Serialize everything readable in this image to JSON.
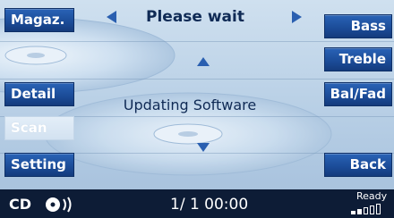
{
  "left_menu": {
    "magazine_label": "Magaz.",
    "detail_label": "Detail",
    "scan_label": "Scan",
    "setting_label": "Setting"
  },
  "right_menu": {
    "bass_label": "Bass",
    "treble_label": "Treble",
    "balance_fader_label": "Bal/Fad",
    "back_label": "Back"
  },
  "header": {
    "title": "Please wait"
  },
  "main": {
    "status_message": "Updating Software"
  },
  "status_bar": {
    "source": "CD",
    "track_time": "1/  1 00:00",
    "ready": "Ready",
    "signal_bars_filled": 2,
    "signal_bars_total": 5
  },
  "icons": {
    "prev": "left-triangle-icon",
    "next": "right-triangle-icon",
    "scroll_up": "up-triangle-icon",
    "scroll_down": "down-triangle-icon",
    "cd": "cd-disc-icon",
    "signal": "signal-strength-icon"
  },
  "colors": {
    "button": "#1b4b97",
    "screen_bg": "#b9d0e6",
    "status_bar": "#0d1c36",
    "text_dark": "#0f2a55"
  }
}
